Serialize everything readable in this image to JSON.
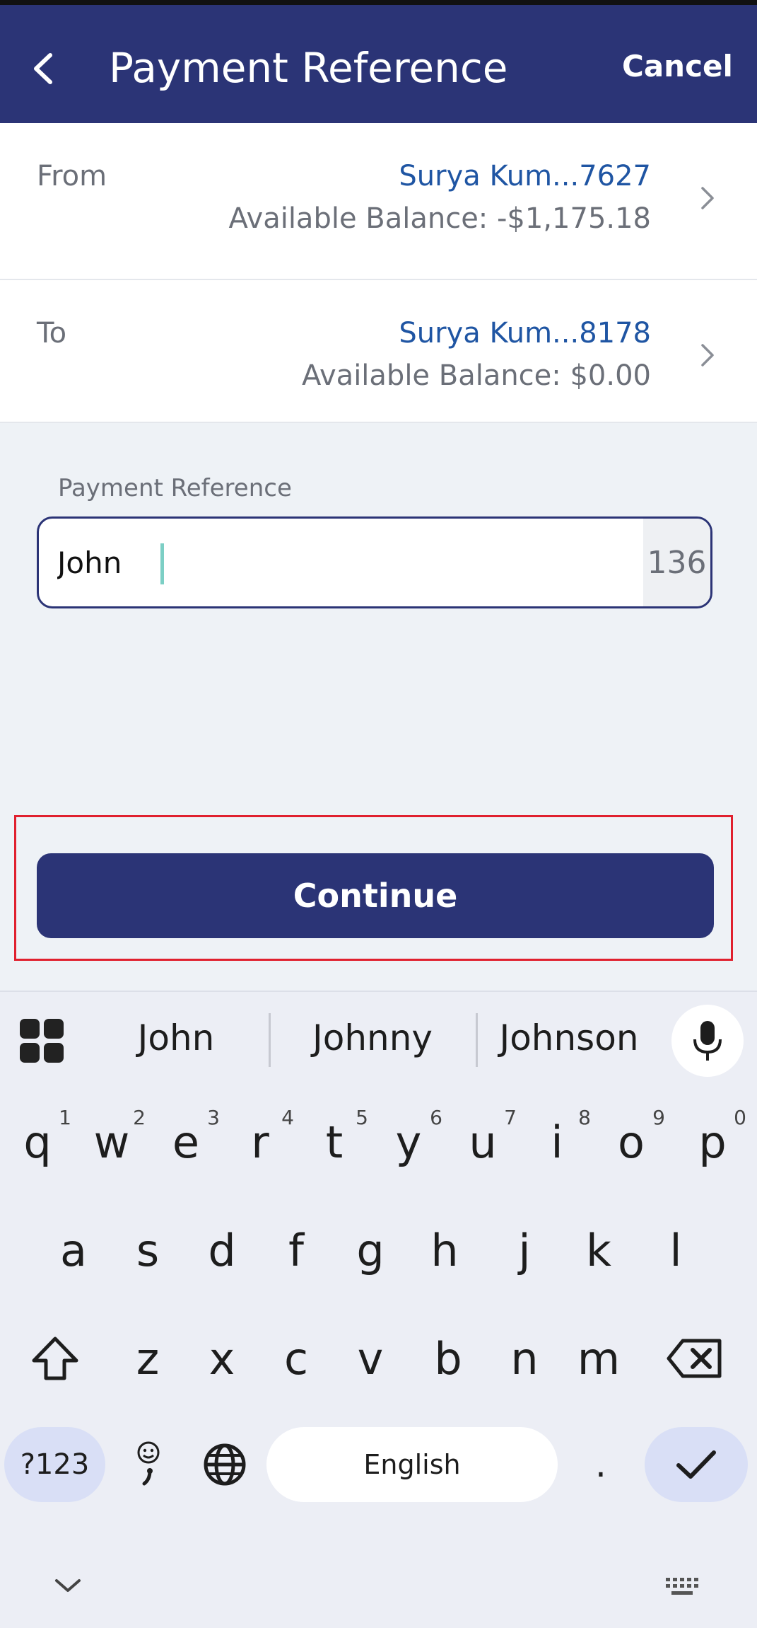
{
  "header": {
    "title": "Payment Reference",
    "cancel_label": "Cancel"
  },
  "from": {
    "label": "From",
    "account": "Surya Kum...7627",
    "balance": "Available Balance:  -$1,175.18"
  },
  "to": {
    "label": "To",
    "account": "Surya Kum...8178",
    "balance": "Available Balance:  $0.00"
  },
  "reference": {
    "label": "Payment Reference",
    "value": "John",
    "remaining": "136"
  },
  "continue_label": "Continue",
  "keyboard": {
    "suggestions": [
      "John",
      "Johnny",
      "Johnson"
    ],
    "row1": [
      {
        "k": "q",
        "n": "1"
      },
      {
        "k": "w",
        "n": "2"
      },
      {
        "k": "e",
        "n": "3"
      },
      {
        "k": "r",
        "n": "4"
      },
      {
        "k": "t",
        "n": "5"
      },
      {
        "k": "y",
        "n": "6"
      },
      {
        "k": "u",
        "n": "7"
      },
      {
        "k": "i",
        "n": "8"
      },
      {
        "k": "o",
        "n": "9"
      },
      {
        "k": "p",
        "n": "0"
      }
    ],
    "row2": [
      "a",
      "s",
      "d",
      "f",
      "g",
      "h",
      "j",
      "k",
      "l"
    ],
    "row3": [
      "z",
      "x",
      "c",
      "v",
      "b",
      "n",
      "m"
    ],
    "symbols_label": "?123",
    "space_label": "English",
    "period_label": "."
  }
}
